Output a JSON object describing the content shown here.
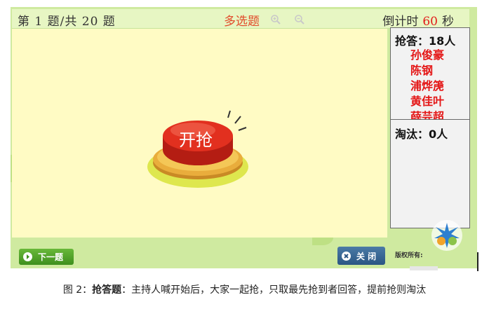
{
  "topbar": {
    "question_counter": "第 1 题/共 20 题",
    "question_type": "多选题",
    "timer_label": "倒计时",
    "timer_value": "60",
    "timer_unit": "秒"
  },
  "buzzer": {
    "label": "开抢"
  },
  "panel": {
    "answered_title": "抢答：18人",
    "names": [
      "孙俊豪",
      "陈钢",
      "浦烨箎",
      "黄佳叶",
      "薛芸超"
    ],
    "eliminated_title": "淘汰：0人"
  },
  "footer": {
    "next_label": "下一题",
    "close_label": "关 闭",
    "copyright_label": "版权所有:"
  },
  "caption": {
    "prefix": "图 2：",
    "term": "抢答题",
    "text": "：主持人喊开始后，大家一起抢，只取最先抢到者回答，提前抢则淘汰"
  },
  "colors": {
    "accent_red": "#e21b1b",
    "stage_bg": "#fffbc4",
    "app_bg": "#cfeaa0",
    "close_btn": "#2b5683",
    "next_btn": "#3e8f1d"
  }
}
